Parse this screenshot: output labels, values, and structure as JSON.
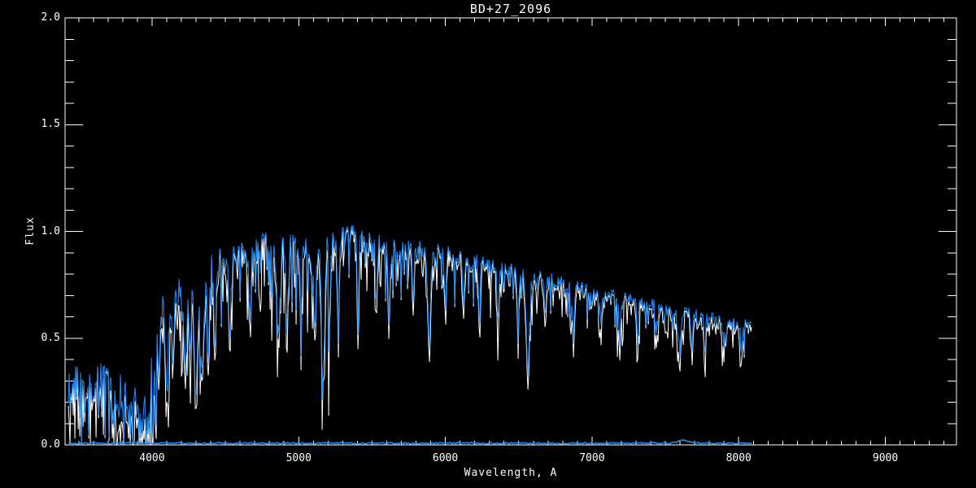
{
  "window": {
    "background_color": "#000000",
    "foreground_color": "#ffffff"
  },
  "chart_data": {
    "type": "line",
    "title": "BD+27_2096",
    "xlabel": "Wavelength, A",
    "ylabel": "Flux",
    "background_color": "#000000",
    "axis_color": "#ffffff",
    "grid": false,
    "legend": "none",
    "xlim": [
      3407,
      9485
    ],
    "ylim": [
      0.0,
      2.0
    ],
    "x_major_ticks": [
      {
        "value": 4000,
        "label": "4000"
      },
      {
        "value": 5000,
        "label": "5000"
      },
      {
        "value": 6000,
        "label": "6000"
      },
      {
        "value": 7000,
        "label": "7000"
      },
      {
        "value": 8000,
        "label": "8000"
      },
      {
        "value": 9000,
        "label": "9000"
      }
    ],
    "y_major_ticks": [
      {
        "value": 0.0,
        "label": "0.0"
      },
      {
        "value": 0.5,
        "label": "0.5"
      },
      {
        "value": 1.0,
        "label": "1.0"
      },
      {
        "value": 1.5,
        "label": "1.5"
      },
      {
        "value": 2.0,
        "label": "2.0"
      }
    ],
    "x_minor_step": 100,
    "y_minor_step": 0.1,
    "data_wavelength_range": [
      3430,
      8090
    ],
    "series": [
      {
        "name": "spectrum-white-underlay",
        "color": "#ffffff",
        "style": "noisy line, deeper absorption dips, drawn first"
      },
      {
        "name": "spectrum-blue-overlay",
        "color": "#1e8cff",
        "style": "noisy line drawn on top of white spectrum"
      },
      {
        "name": "error-floor",
        "color": "#1e8cff",
        "level": 0.008,
        "style": "flat noisy line just above zero"
      }
    ],
    "continuum": [
      [
        3430,
        0.26
      ],
      [
        3470,
        0.3
      ],
      [
        3510,
        0.29
      ],
      [
        3550,
        0.27
      ],
      [
        3590,
        0.26
      ],
      [
        3630,
        0.3
      ],
      [
        3670,
        0.33
      ],
      [
        3710,
        0.32
      ],
      [
        3750,
        0.28
      ],
      [
        3790,
        0.27
      ],
      [
        3830,
        0.24
      ],
      [
        3870,
        0.29
      ],
      [
        3900,
        0.25
      ],
      [
        3930,
        0.18
      ],
      [
        3960,
        0.22
      ],
      [
        3990,
        0.35
      ],
      [
        4020,
        0.5
      ],
      [
        4050,
        0.62
      ],
      [
        4080,
        0.66
      ],
      [
        4110,
        0.7
      ],
      [
        4140,
        0.74
      ],
      [
        4170,
        0.73
      ],
      [
        4200,
        0.7
      ],
      [
        4230,
        0.72
      ],
      [
        4260,
        0.74
      ],
      [
        4290,
        0.7
      ],
      [
        4320,
        0.73
      ],
      [
        4350,
        0.78
      ],
      [
        4390,
        0.84
      ],
      [
        4430,
        0.87
      ],
      [
        4470,
        0.86
      ],
      [
        4510,
        0.88
      ],
      [
        4550,
        0.9
      ],
      [
        4590,
        0.89
      ],
      [
        4630,
        0.88
      ],
      [
        4670,
        0.89
      ],
      [
        4710,
        0.92
      ],
      [
        4750,
        0.94
      ],
      [
        4790,
        0.95
      ],
      [
        4830,
        0.93
      ],
      [
        4870,
        0.92
      ],
      [
        4910,
        0.93
      ],
      [
        4950,
        0.94
      ],
      [
        5000,
        0.93
      ],
      [
        5050,
        0.92
      ],
      [
        5100,
        0.9
      ],
      [
        5150,
        0.89
      ],
      [
        5200,
        0.95
      ],
      [
        5250,
        0.99
      ],
      [
        5300,
        1.0
      ],
      [
        5350,
        0.99
      ],
      [
        5400,
        0.97
      ],
      [
        5450,
        0.96
      ],
      [
        5500,
        0.95
      ],
      [
        5550,
        0.95
      ],
      [
        5600,
        0.94
      ],
      [
        5650,
        0.93
      ],
      [
        5700,
        0.93
      ],
      [
        5750,
        0.92
      ],
      [
        5800,
        0.92
      ],
      [
        5850,
        0.91
      ],
      [
        5900,
        0.9
      ],
      [
        5950,
        0.9
      ],
      [
        6000,
        0.89
      ],
      [
        6050,
        0.89
      ],
      [
        6100,
        0.87
      ],
      [
        6150,
        0.86
      ],
      [
        6200,
        0.86
      ],
      [
        6250,
        0.85
      ],
      [
        6300,
        0.84
      ],
      [
        6350,
        0.83
      ],
      [
        6400,
        0.82
      ],
      [
        6450,
        0.81
      ],
      [
        6500,
        0.8
      ],
      [
        6550,
        0.79
      ],
      [
        6600,
        0.78
      ],
      [
        6650,
        0.78
      ],
      [
        6700,
        0.77
      ],
      [
        6750,
        0.77
      ],
      [
        6800,
        0.76
      ],
      [
        6850,
        0.75
      ],
      [
        6900,
        0.74
      ],
      [
        6950,
        0.73
      ],
      [
        7000,
        0.72
      ],
      [
        7050,
        0.71
      ],
      [
        7100,
        0.7
      ],
      [
        7150,
        0.7
      ],
      [
        7200,
        0.69
      ],
      [
        7250,
        0.68
      ],
      [
        7300,
        0.67
      ],
      [
        7350,
        0.66
      ],
      [
        7400,
        0.66
      ],
      [
        7450,
        0.65
      ],
      [
        7500,
        0.64
      ],
      [
        7550,
        0.63
      ],
      [
        7600,
        0.62
      ],
      [
        7650,
        0.62
      ],
      [
        7700,
        0.61
      ],
      [
        7750,
        0.6
      ],
      [
        7800,
        0.6
      ],
      [
        7850,
        0.59
      ],
      [
        7900,
        0.58
      ],
      [
        7950,
        0.57
      ],
      [
        8000,
        0.57
      ],
      [
        8050,
        0.56
      ],
      [
        8090,
        0.55
      ]
    ],
    "noise_sigma": [
      [
        3430,
        0.075
      ],
      [
        3700,
        0.07
      ],
      [
        3900,
        0.09
      ],
      [
        3990,
        0.1
      ],
      [
        4100,
        0.085
      ],
      [
        4300,
        0.08
      ],
      [
        4500,
        0.065
      ],
      [
        4800,
        0.06
      ],
      [
        5100,
        0.055
      ],
      [
        5400,
        0.05
      ],
      [
        5700,
        0.045
      ],
      [
        6000,
        0.042
      ],
      [
        6300,
        0.04
      ],
      [
        6600,
        0.035
      ],
      [
        7000,
        0.032
      ],
      [
        7400,
        0.03
      ],
      [
        7800,
        0.028
      ],
      [
        8090,
        0.028
      ]
    ],
    "absorption_lines": [
      [
        3735,
        0.1,
        7
      ],
      [
        3770,
        0.12,
        7
      ],
      [
        3800,
        0.1,
        7
      ],
      [
        3835,
        0.08,
        7
      ],
      [
        3870,
        0.12,
        7
      ],
      [
        3910,
        0.1,
        9
      ],
      [
        3933,
        0.04,
        12
      ],
      [
        3968,
        0.05,
        12
      ],
      [
        3985,
        0.05,
        5
      ],
      [
        4005,
        0.04,
        5
      ],
      [
        4026,
        0.07,
        5
      ],
      [
        4045,
        0.28,
        7
      ],
      [
        4101,
        0.27,
        10
      ],
      [
        4144,
        0.4,
        8
      ],
      [
        4226,
        0.32,
        10
      ],
      [
        4260,
        0.42,
        7
      ],
      [
        4300,
        0.36,
        10
      ],
      [
        4340,
        0.38,
        10
      ],
      [
        4383,
        0.42,
        7
      ],
      [
        4430,
        0.48,
        7
      ],
      [
        4530,
        0.52,
        7
      ],
      [
        4668,
        0.58,
        7
      ],
      [
        4861,
        0.52,
        10
      ],
      [
        4920,
        0.58,
        6
      ],
      [
        5015,
        0.58,
        6
      ],
      [
        5110,
        0.55,
        6
      ],
      [
        5167,
        0.33,
        10
      ],
      [
        5210,
        0.6,
        6
      ],
      [
        5270,
        0.58,
        7
      ],
      [
        5405,
        0.6,
        6
      ],
      [
        5530,
        0.63,
        6
      ],
      [
        5615,
        0.6,
        6
      ],
      [
        5782,
        0.66,
        6
      ],
      [
        5890,
        0.47,
        9
      ],
      [
        6000,
        0.68,
        6
      ],
      [
        6122,
        0.66,
        6
      ],
      [
        6230,
        0.64,
        6
      ],
      [
        6360,
        0.62,
        6
      ],
      [
        6495,
        0.6,
        6
      ],
      [
        6563,
        0.33,
        10
      ],
      [
        6680,
        0.63,
        6
      ],
      [
        6870,
        0.58,
        8
      ],
      [
        7060,
        0.56,
        6
      ],
      [
        7190,
        0.53,
        8
      ],
      [
        7310,
        0.53,
        6
      ],
      [
        7440,
        0.52,
        6
      ],
      [
        7594,
        0.47,
        10
      ],
      [
        7680,
        0.5,
        6
      ],
      [
        7770,
        0.49,
        6
      ],
      [
        7900,
        0.48,
        6
      ],
      [
        8020,
        0.46,
        6
      ]
    ],
    "error_floor": {
      "level": 0.008,
      "noise_amplitude": 0.007,
      "telluric_bump": {
        "wavelength": 7620,
        "height": 0.014,
        "width": 35
      }
    }
  }
}
